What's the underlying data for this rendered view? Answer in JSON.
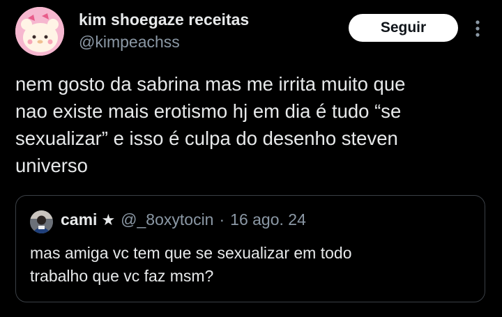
{
  "author": {
    "name": "kim shoegaze receitas",
    "handle": "@kimpeachss",
    "avatar_icon": "cartoon-character-avatar-icon"
  },
  "actions": {
    "follow_label": "Seguir",
    "more_icon": "more-vertical-icon"
  },
  "tweet": {
    "text": "nem gosto da sabrina mas me irrita muito que\nnao existe mais erotismo hj em dia é tudo “se\nsexualizar” e isso é culpa do desenho steven\nuniverso"
  },
  "quote": {
    "name": "cami",
    "star": "★",
    "handle": "@_8oxytocin",
    "separator": "·",
    "date": "16 ago. 24",
    "text": "mas amiga vc tem que se sexualizar em todo\ntrabalho que vc faz msm?"
  },
  "colors": {
    "background": "#000000",
    "text": "#e7e9ea",
    "secondary_text": "#8b98a5",
    "border": "#3b4046",
    "button_bg": "#ffffff"
  }
}
